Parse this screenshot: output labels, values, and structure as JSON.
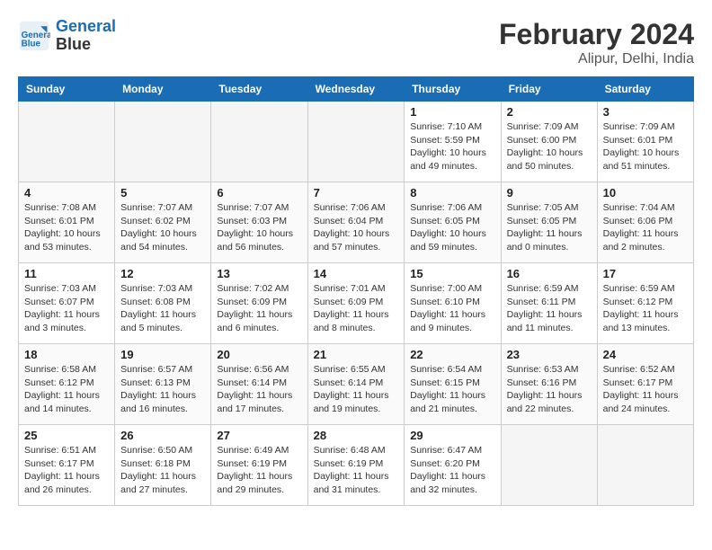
{
  "header": {
    "logo_line1": "General",
    "logo_line2": "Blue",
    "month_year": "February 2024",
    "location": "Alipur, Delhi, India"
  },
  "weekdays": [
    "Sunday",
    "Monday",
    "Tuesday",
    "Wednesday",
    "Thursday",
    "Friday",
    "Saturday"
  ],
  "weeks": [
    [
      {
        "day": "",
        "info": ""
      },
      {
        "day": "",
        "info": ""
      },
      {
        "day": "",
        "info": ""
      },
      {
        "day": "",
        "info": ""
      },
      {
        "day": "1",
        "info": "Sunrise: 7:10 AM\nSunset: 5:59 PM\nDaylight: 10 hours\nand 49 minutes."
      },
      {
        "day": "2",
        "info": "Sunrise: 7:09 AM\nSunset: 6:00 PM\nDaylight: 10 hours\nand 50 minutes."
      },
      {
        "day": "3",
        "info": "Sunrise: 7:09 AM\nSunset: 6:01 PM\nDaylight: 10 hours\nand 51 minutes."
      }
    ],
    [
      {
        "day": "4",
        "info": "Sunrise: 7:08 AM\nSunset: 6:01 PM\nDaylight: 10 hours\nand 53 minutes."
      },
      {
        "day": "5",
        "info": "Sunrise: 7:07 AM\nSunset: 6:02 PM\nDaylight: 10 hours\nand 54 minutes."
      },
      {
        "day": "6",
        "info": "Sunrise: 7:07 AM\nSunset: 6:03 PM\nDaylight: 10 hours\nand 56 minutes."
      },
      {
        "day": "7",
        "info": "Sunrise: 7:06 AM\nSunset: 6:04 PM\nDaylight: 10 hours\nand 57 minutes."
      },
      {
        "day": "8",
        "info": "Sunrise: 7:06 AM\nSunset: 6:05 PM\nDaylight: 10 hours\nand 59 minutes."
      },
      {
        "day": "9",
        "info": "Sunrise: 7:05 AM\nSunset: 6:05 PM\nDaylight: 11 hours\nand 0 minutes."
      },
      {
        "day": "10",
        "info": "Sunrise: 7:04 AM\nSunset: 6:06 PM\nDaylight: 11 hours\nand 2 minutes."
      }
    ],
    [
      {
        "day": "11",
        "info": "Sunrise: 7:03 AM\nSunset: 6:07 PM\nDaylight: 11 hours\nand 3 minutes."
      },
      {
        "day": "12",
        "info": "Sunrise: 7:03 AM\nSunset: 6:08 PM\nDaylight: 11 hours\nand 5 minutes."
      },
      {
        "day": "13",
        "info": "Sunrise: 7:02 AM\nSunset: 6:09 PM\nDaylight: 11 hours\nand 6 minutes."
      },
      {
        "day": "14",
        "info": "Sunrise: 7:01 AM\nSunset: 6:09 PM\nDaylight: 11 hours\nand 8 minutes."
      },
      {
        "day": "15",
        "info": "Sunrise: 7:00 AM\nSunset: 6:10 PM\nDaylight: 11 hours\nand 9 minutes."
      },
      {
        "day": "16",
        "info": "Sunrise: 6:59 AM\nSunset: 6:11 PM\nDaylight: 11 hours\nand 11 minutes."
      },
      {
        "day": "17",
        "info": "Sunrise: 6:59 AM\nSunset: 6:12 PM\nDaylight: 11 hours\nand 13 minutes."
      }
    ],
    [
      {
        "day": "18",
        "info": "Sunrise: 6:58 AM\nSunset: 6:12 PM\nDaylight: 11 hours\nand 14 minutes."
      },
      {
        "day": "19",
        "info": "Sunrise: 6:57 AM\nSunset: 6:13 PM\nDaylight: 11 hours\nand 16 minutes."
      },
      {
        "day": "20",
        "info": "Sunrise: 6:56 AM\nSunset: 6:14 PM\nDaylight: 11 hours\nand 17 minutes."
      },
      {
        "day": "21",
        "info": "Sunrise: 6:55 AM\nSunset: 6:14 PM\nDaylight: 11 hours\nand 19 minutes."
      },
      {
        "day": "22",
        "info": "Sunrise: 6:54 AM\nSunset: 6:15 PM\nDaylight: 11 hours\nand 21 minutes."
      },
      {
        "day": "23",
        "info": "Sunrise: 6:53 AM\nSunset: 6:16 PM\nDaylight: 11 hours\nand 22 minutes."
      },
      {
        "day": "24",
        "info": "Sunrise: 6:52 AM\nSunset: 6:17 PM\nDaylight: 11 hours\nand 24 minutes."
      }
    ],
    [
      {
        "day": "25",
        "info": "Sunrise: 6:51 AM\nSunset: 6:17 PM\nDaylight: 11 hours\nand 26 minutes."
      },
      {
        "day": "26",
        "info": "Sunrise: 6:50 AM\nSunset: 6:18 PM\nDaylight: 11 hours\nand 27 minutes."
      },
      {
        "day": "27",
        "info": "Sunrise: 6:49 AM\nSunset: 6:19 PM\nDaylight: 11 hours\nand 29 minutes."
      },
      {
        "day": "28",
        "info": "Sunrise: 6:48 AM\nSunset: 6:19 PM\nDaylight: 11 hours\nand 31 minutes."
      },
      {
        "day": "29",
        "info": "Sunrise: 6:47 AM\nSunset: 6:20 PM\nDaylight: 11 hours\nand 32 minutes."
      },
      {
        "day": "",
        "info": ""
      },
      {
        "day": "",
        "info": ""
      }
    ]
  ]
}
